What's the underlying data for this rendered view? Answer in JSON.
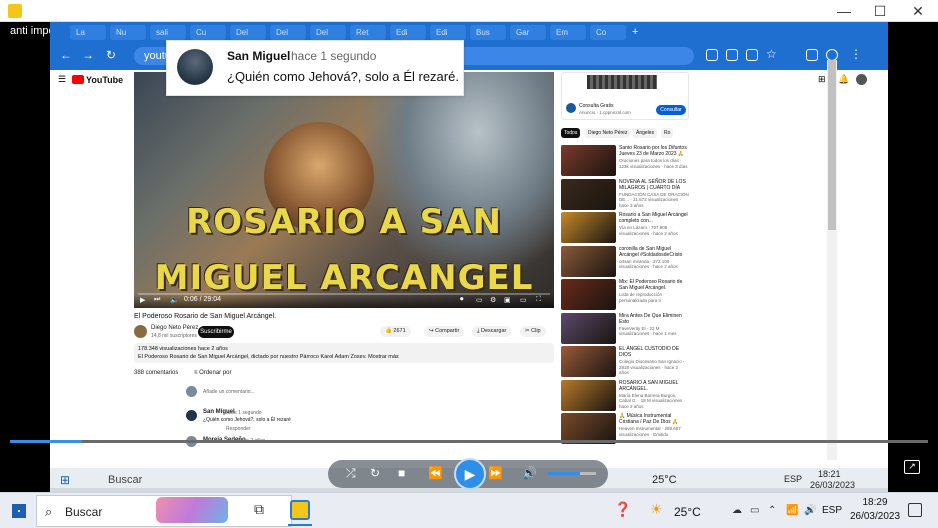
{
  "window": {
    "title": "anti impostor"
  },
  "browser": {
    "tabs": [
      "La",
      "Nu",
      "sali",
      "Cu",
      "Del",
      "Del",
      "Del",
      "Ret",
      "Edi",
      "Edi",
      "Bus",
      "Gar",
      "Em",
      "Co"
    ],
    "url": "youtube.com/watch?v=s-s-TViFfyo"
  },
  "comment_popup": {
    "name": "San Miguel",
    "time": "hace 1 segundo",
    "text": "¿Quién como Jehová?, solo a Él rezaré."
  },
  "video": {
    "overlay_line1": "ROSARIO A SAN",
    "overlay_line2": "MIGUEL ARCANGEL",
    "time": "0:06 / 29:04",
    "title": "El Poderoso Rosario de San Miguel Arcángel.",
    "channel": "Diego Neto Pérez",
    "subs": "14,8 mil suscriptores",
    "subscribe": "Suscribirme",
    "likes": "2671",
    "share": "Compartir",
    "download": "Descargar",
    "clip": "Clip",
    "desc_meta": "178.348 visualizaciones  hace 2 años",
    "desc_text": "El Poderoso Rosario de San Miguel Arcángel, dictado por nuestro Párroco Karol Adam Zosev.  Mostrar más"
  },
  "comments": {
    "count": "388 comentarios",
    "sort": "Ordenar por",
    "add": "Añade un comentario...",
    "c1_name": "San Miguel",
    "c1_time": "hace 1 segundo",
    "c1_text": "¿Quién como Jehová?, solo a Él rezaré",
    "reply": "Responder",
    "c2_name": "Moreja Sedeño",
    "c2_time": "hace 2 años"
  },
  "ad": {
    "title": "Consulta Gratis",
    "sub": "Anuncio · 1.cppnicral.com",
    "button": "Consultar"
  },
  "chips": [
    "Todos",
    "Diego Neto Pérez",
    "Ángeles",
    "Ro"
  ],
  "recs": [
    {
      "title": "Santo Rosario por los Difuntos Jueves 23 de Marzo 2023 🙏",
      "meta": "Oraciones para todos los días · 123k visualizaciones · hace 3 días",
      "color": "#7a3a2a"
    },
    {
      "title": "NOVENA AL SEÑOR DE LOS MILAGROS | CUARTO DÍA",
      "meta": "FUNDACIÓN CASA DE ORACIÓN DE... · 21.672 visualizaciones · hace 3 años",
      "color": "#3a2a1a"
    },
    {
      "title": "Rosario a San Miguel Arcángel completo con...",
      "meta": "Vía en Lázaro · 707.808 visualizaciones · hace 2 años",
      "color": "#c58a2a"
    },
    {
      "title": "coronilla de San Miguel Arcángel #SoldadosdeCristo",
      "meta": "ortsan miranda · 372.100 visualizaciones · hace 2 años",
      "color": "#8a5a3a"
    },
    {
      "title": "Mix: El Poderoso Rosario de San Miguel Arcángel.",
      "meta": "Lista de reproducción personalizada para ti",
      "color": "#6a2a1a"
    },
    {
      "title": "Mira Antes De Que Eliminen Esto",
      "meta": "FaveVerity El · 22 M visualizaciones · hace 1 mes",
      "color": "#5a4a6a"
    },
    {
      "title": "EL ÁNGEL CUSTODIO DE DIOS",
      "meta": "Colegio Diocesano San Ignacio · 2818 visualizaciones · hace 2 años",
      "color": "#9a5a3a"
    },
    {
      "title": "ROSARIO A SAN MIGUEL ARCÁNGEL.",
      "meta": "María Elena Barrera Burgos, Cabal G. · 18 M visualizaciones · hace 2 años",
      "color": "#b87a2a"
    },
    {
      "title": "🙏 Música Instrumental Cristiana / Paz De Dios 🙏",
      "meta": "Heaven Instrumental · 289.607 visualizaciones · Emitido",
      "color": "#7a4a2a"
    }
  ],
  "inner_taskbar": {
    "search": "Buscar",
    "temp": "25°C",
    "ime": "ESP",
    "time": "18:21",
    "date": "26/03/2023"
  },
  "taskbar": {
    "search": "Buscar",
    "temp": "25°C",
    "ime": "ESP",
    "time": "18:29",
    "date": "26/03/2023"
  }
}
